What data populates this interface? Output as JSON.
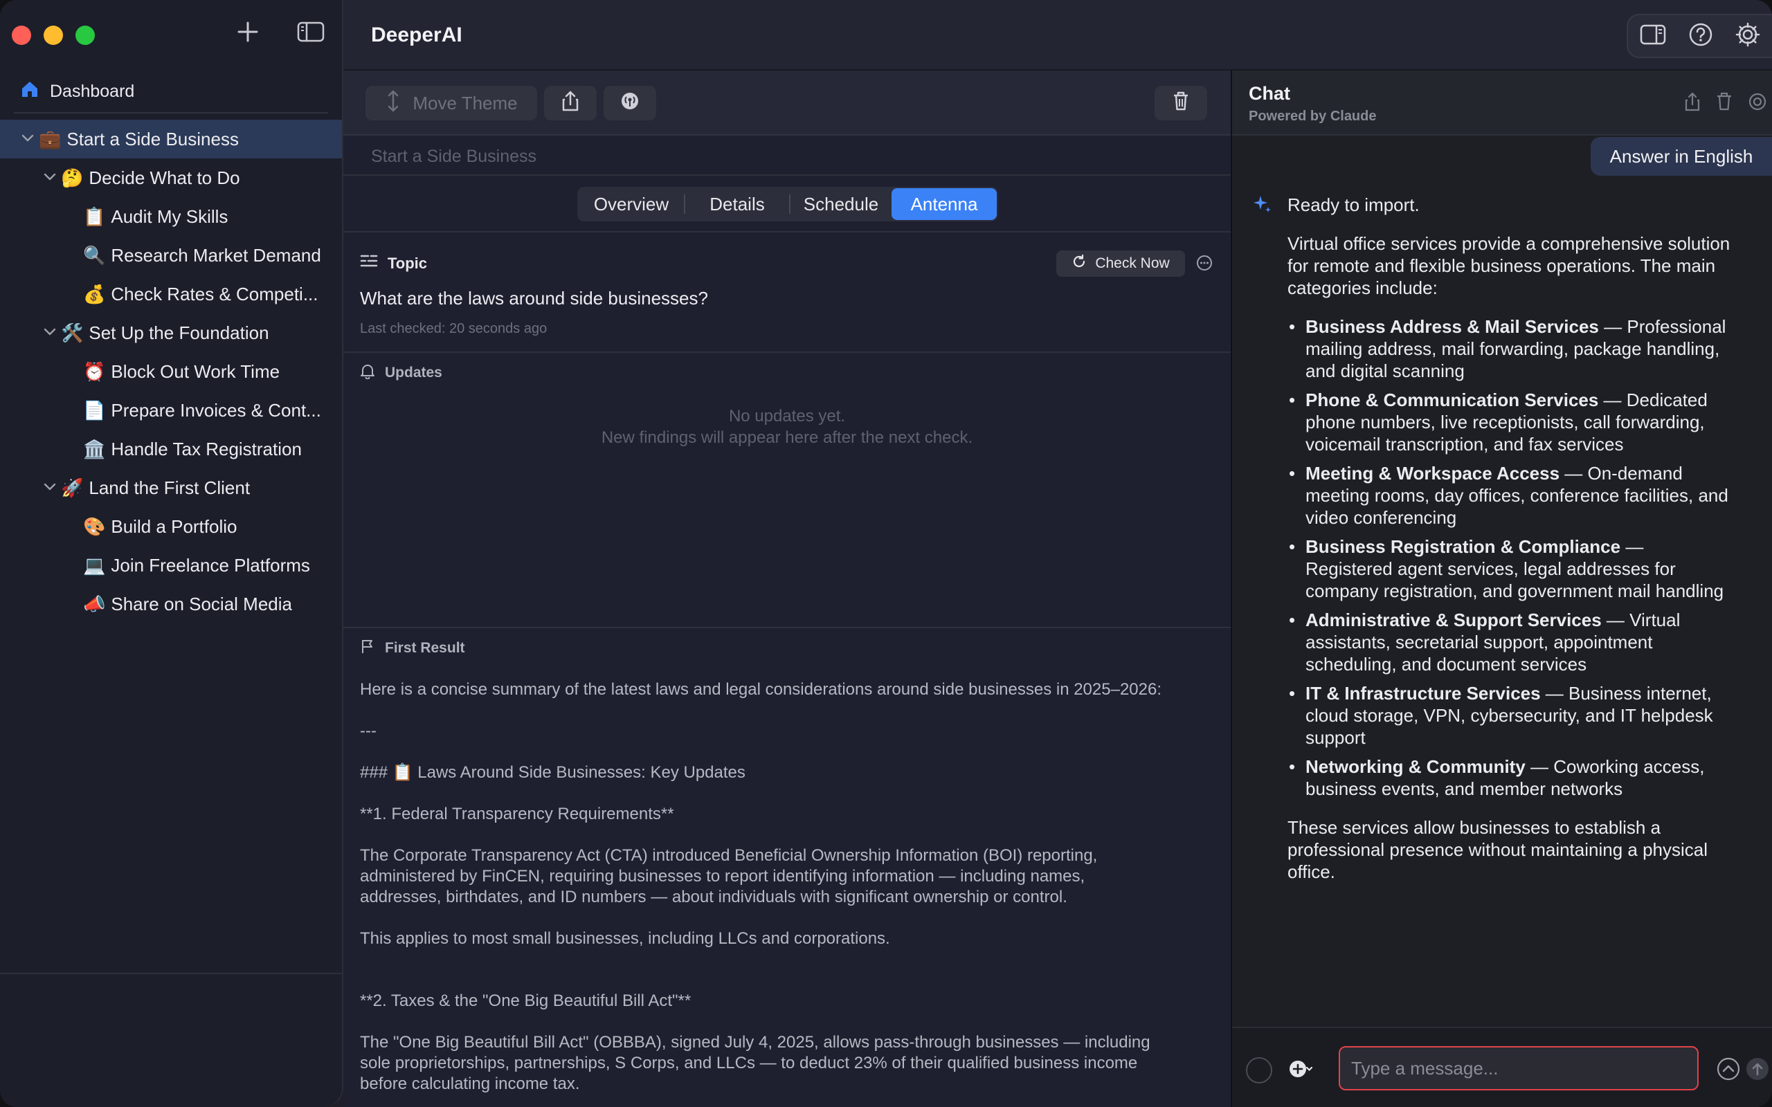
{
  "app": {
    "title": "DeeperAI"
  },
  "sidebar": {
    "dashboard_label": "Dashboard",
    "tree": [
      {
        "level": 0,
        "chevron": true,
        "emoji": "💼",
        "label": "Start a Side Business",
        "active": true
      },
      {
        "level": 1,
        "chevron": true,
        "emoji": "🤔",
        "label": "Decide What to Do"
      },
      {
        "level": 2,
        "chevron": false,
        "emoji": "📋",
        "label": "Audit My Skills"
      },
      {
        "level": 2,
        "chevron": false,
        "emoji": "🔍",
        "label": "Research Market Demand"
      },
      {
        "level": 2,
        "chevron": false,
        "emoji": "💰",
        "label": "Check Rates & Competi..."
      },
      {
        "level": 1,
        "chevron": true,
        "emoji": "🛠️",
        "label": "Set Up the Foundation"
      },
      {
        "level": 2,
        "chevron": false,
        "emoji": "⏰",
        "label": "Block Out Work Time"
      },
      {
        "level": 2,
        "chevron": false,
        "emoji": "📄",
        "label": "Prepare Invoices & Cont..."
      },
      {
        "level": 2,
        "chevron": false,
        "emoji": "🏛️",
        "label": "Handle Tax Registration"
      },
      {
        "level": 1,
        "chevron": true,
        "emoji": "🚀",
        "label": "Land the First Client"
      },
      {
        "level": 2,
        "chevron": false,
        "emoji": "🎨",
        "label": "Build a Portfolio"
      },
      {
        "level": 2,
        "chevron": false,
        "emoji": "💻",
        "label": "Join Freelance Platforms"
      },
      {
        "level": 2,
        "chevron": false,
        "emoji": "📣",
        "label": "Share on Social Media"
      }
    ]
  },
  "toolbar": {
    "move_theme_label": "Move Theme"
  },
  "breadcrumb": "Start a Side Business",
  "tabs": [
    {
      "label": "Overview",
      "active": false
    },
    {
      "label": "Details",
      "active": false
    },
    {
      "label": "Schedule",
      "active": false
    },
    {
      "label": "Antenna",
      "active": true
    }
  ],
  "topic": {
    "heading": "Topic",
    "check_now_label": "Check Now",
    "question": "What are the laws around side businesses?",
    "last_checked": "Last checked: 20 seconds ago"
  },
  "updates": {
    "heading": "Updates",
    "empty_line1": "No updates yet.",
    "empty_line2": "New findings will appear here after the next check."
  },
  "first_result": {
    "heading": "First Result",
    "body": "Here is a concise summary of the latest laws and legal considerations around side businesses in 2025–2026:\n\n---\n\n### 📋 Laws Around Side Businesses: Key Updates\n\n**1. Federal Transparency Requirements**\n\nThe Corporate Transparency Act (CTA) introduced Beneficial Ownership Information (BOI) reporting,\nadministered by FinCEN, requiring businesses to report identifying information — including names,\naddresses, birthdates, and ID numbers — about individuals with significant ownership or control.\n\nThis applies to most small businesses, including LLCs and corporations.\n\n\n**2. Taxes & the \"One Big Beautiful Bill Act\"**\n\nThe \"One Big Beautiful Bill Act\" (OBBBA), signed July 4, 2025, allows pass-through businesses — including\nsole proprietorships, partnerships, S Corps, and LLCs — to deduct 23% of their qualified business income\nbefore calculating income tax."
  },
  "chat": {
    "title": "Chat",
    "subtitle": "Powered by Claude",
    "answer_lang": "Answer in English",
    "intro": "Ready to import.",
    "para1": "Virtual office services provide a comprehensive solution for remote and flexible business operations. The main categories include:",
    "items": [
      {
        "title": "Business Address & Mail Services",
        "desc": " — Professional mailing address, mail forwarding, package handling, and digital scanning"
      },
      {
        "title": "Phone & Communication Services",
        "desc": " — Dedicated phone numbers, live receptionists, call forwarding, voicemail transcription, and fax services"
      },
      {
        "title": "Meeting & Workspace Access",
        "desc": " — On-demand meeting rooms, day offices, conference facilities, and video conferencing"
      },
      {
        "title": "Business Registration & Compliance",
        "desc": " — Registered agent services, legal addresses for company registration, and government mail handling"
      },
      {
        "title": "Administrative & Support Services",
        "desc": " — Virtual assistants, secretarial support, appointment scheduling, and document services"
      },
      {
        "title": "IT & Infrastructure Services",
        "desc": " — Business internet, cloud storage, VPN, cybersecurity, and IT helpdesk support"
      },
      {
        "title": "Networking & Community",
        "desc": " — Coworking access, business events, and member networks"
      }
    ],
    "closing": "These services allow businesses to establish a professional presence without maintaining a physical office.",
    "input_placeholder": "Type a message..."
  },
  "colors": {
    "accent": "#3b82f6",
    "input_border": "#e0434a",
    "active_row": "#2b3a58"
  },
  "icons": [
    "plus-icon",
    "sidebar-toggle-icon",
    "home-icon",
    "move-icon",
    "share-icon",
    "antenna-icon",
    "trash-icon",
    "panel-icon",
    "help-icon",
    "gear-icon",
    "refresh-icon",
    "more-icon",
    "bell-icon",
    "flag-icon",
    "sparkle-icon",
    "add-circle-icon",
    "chevron-down-icon",
    "chevron-up-circle-icon",
    "send-icon"
  ]
}
